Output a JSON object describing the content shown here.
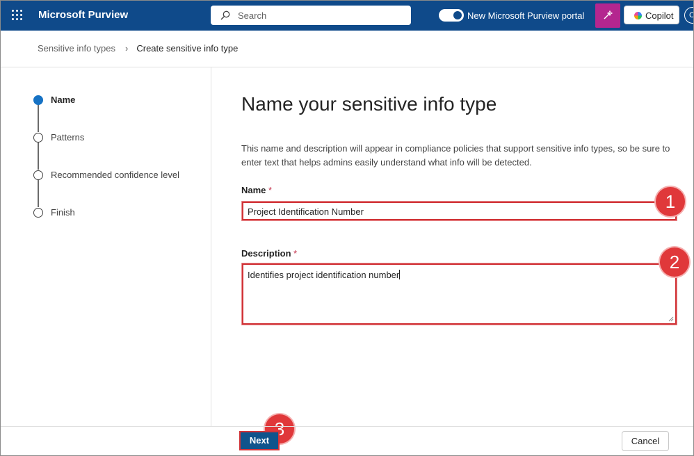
{
  "topbar": {
    "app_title": "Microsoft Purview",
    "search_placeholder": "Search",
    "portal_toggle_label": "New Microsoft Purview portal",
    "portal_toggle_on": true,
    "copilot_label": "Copilot",
    "avatar_initial": "C"
  },
  "breadcrumb": {
    "parent": "Sensitive info types",
    "current": "Create sensitive info type"
  },
  "steps": [
    {
      "label": "Name",
      "active": true
    },
    {
      "label": "Patterns",
      "active": false
    },
    {
      "label": "Recommended confidence level",
      "active": false
    },
    {
      "label": "Finish",
      "active": false
    }
  ],
  "main": {
    "heading": "Name your sensitive info type",
    "description": "This name and description will appear in compliance policies that support sensitive info types, so be sure to enter text that helps admins easily understand what info will be detected.",
    "name_label": "Name",
    "name_value": "Project Identification Number",
    "description_label": "Description",
    "description_value": "Identifies project identification number",
    "required_mark": "*"
  },
  "annotations": [
    "1",
    "2",
    "3"
  ],
  "footer": {
    "next_label": "Next",
    "cancel_label": "Cancel"
  },
  "colors": {
    "topbar": "#0f4a8a",
    "active_step": "#1672c4",
    "primary_button": "#0f548c",
    "highlight_red": "#d13438",
    "copilot_magic": "#b4268f"
  }
}
